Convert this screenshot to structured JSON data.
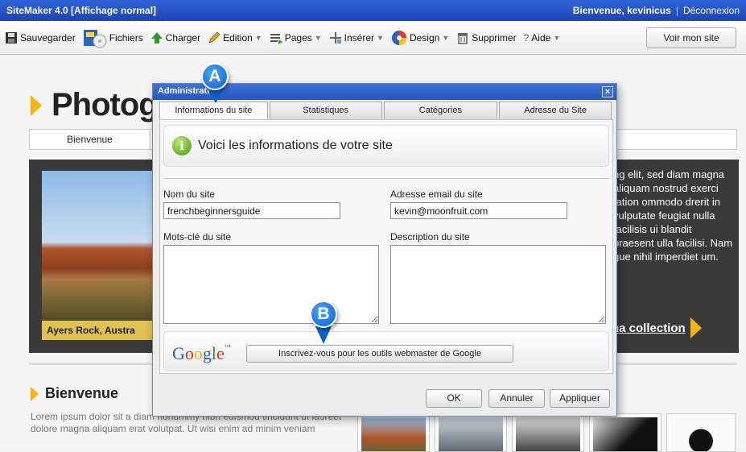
{
  "app": {
    "title": "SiteMaker 4.0  [Affichage normal]",
    "welcome": "Bienvenue, kevinicus",
    "separator": "|",
    "logout": "Déconnexion"
  },
  "toolbar": {
    "save": "Sauvegarder",
    "files": "Fichiers",
    "upload": "Charger",
    "edit": "Edition",
    "pages": "Pages",
    "insert": "Insérer",
    "design": "Design",
    "delete": "Supprimer",
    "help": "Aide",
    "view_site": "Voir mon site"
  },
  "site": {
    "title": "Photogr",
    "nav_first": "Bienvenue",
    "hero_caption": "Ayers Rock, Austra",
    "hero_text": "ng elit, sed diam magna aliquam nostrud exerci tation ommodo drerit in vulputate feugiat nulla facilisis ui blandit praesent ulla facilisi. Nam gue nihil imperdiet um.",
    "hero_link": "na collection",
    "welcome_heading": "Bienvenue",
    "lorem": "Lorem ipsum dolor sit a diam nonummy nibh euismod tincidunt ut laoreet dolore magna aliquam erat volutpat. Ut wisi enim ad minim veniam"
  },
  "dialog": {
    "title": "Administration",
    "close": "×",
    "tabs": [
      "Informations du site",
      "Statistiques",
      "Catégories",
      "Adresse du Site"
    ],
    "info_icon": "info-icon",
    "info_text": "Voici les informations de votre site",
    "site_name_label": "Nom du site",
    "site_name_value": "frenchbeginnersguide",
    "email_label": "Adresse email du site",
    "email_value": "kevin@moonfruit.com",
    "keywords_label": "Mots-clé du site",
    "description_label": "Description du site",
    "google_logo": "Google",
    "google_button": "Inscrivez-vous pour les outils webmaster de Google",
    "ok": "OK",
    "cancel": "Annuler",
    "apply": "Appliquer"
  },
  "callouts": {
    "a": "A",
    "b": "B"
  },
  "colors": {
    "accent": "#f3b41a",
    "titlebar": "#2756bd",
    "callout": "#0b5fcc"
  }
}
